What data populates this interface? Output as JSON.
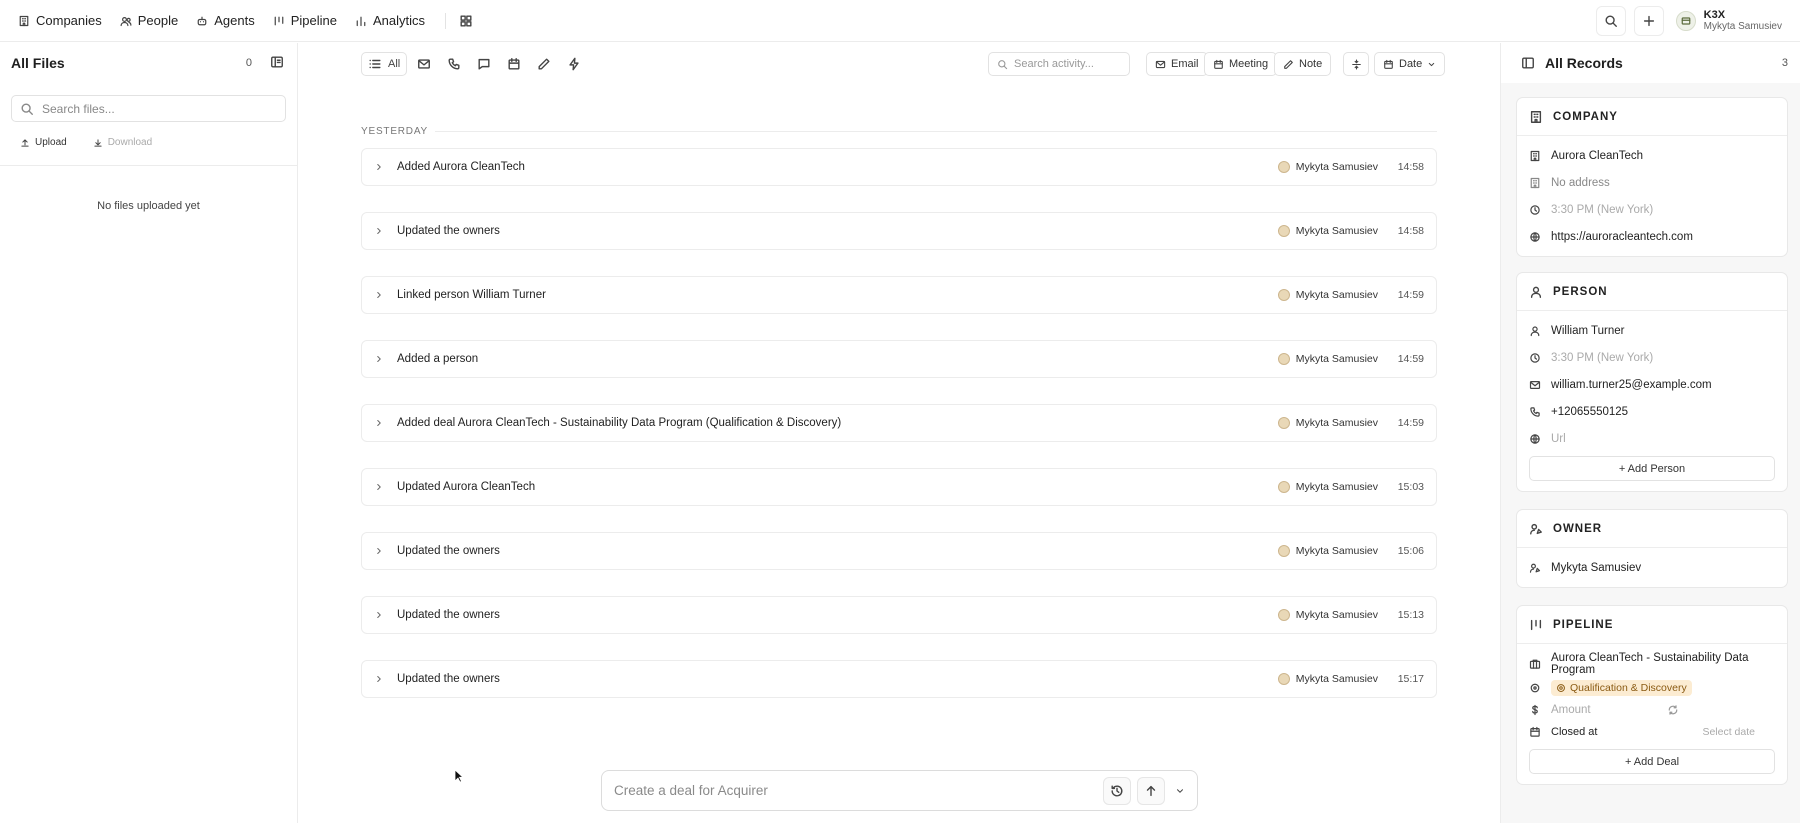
{
  "nav": {
    "items": [
      {
        "label": "Companies",
        "icon": "building-icon"
      },
      {
        "label": "People",
        "icon": "people-icon"
      },
      {
        "label": "Agents",
        "icon": "agent-icon"
      },
      {
        "label": "Pipeline",
        "icon": "pipeline-icon"
      },
      {
        "label": "Analytics",
        "icon": "chart-icon"
      }
    ],
    "account": {
      "name": "K3X",
      "user": "Mykyta Samusiev"
    }
  },
  "files": {
    "title": "All Files",
    "count": "0",
    "search_placeholder": "Search files...",
    "upload_label": "Upload",
    "download_label": "Download",
    "empty_text": "No files uploaded yet"
  },
  "activity": {
    "filter_all": "All",
    "search_placeholder": "Search activity...",
    "email_label": "Email",
    "meeting_label": "Meeting",
    "note_label": "Note",
    "date_label": "Date",
    "day_label": "YESTERDAY",
    "rows": [
      {
        "text": "Added Aurora CleanTech",
        "user": "Mykyta Samusiev",
        "time": "14:58"
      },
      {
        "text": "Updated the owners",
        "user": "Mykyta Samusiev",
        "time": "14:58"
      },
      {
        "text": "Linked person William Turner",
        "user": "Mykyta Samusiev",
        "time": "14:59"
      },
      {
        "text": "Added a person",
        "user": "Mykyta Samusiev",
        "time": "14:59"
      },
      {
        "text": "Added deal Aurora CleanTech - Sustainability Data Program (Qualification & Discovery)",
        "user": "Mykyta Samusiev",
        "time": "14:59"
      },
      {
        "text": "Updated Aurora CleanTech",
        "user": "Mykyta Samusiev",
        "time": "15:03"
      },
      {
        "text": "Updated the owners",
        "user": "Mykyta Samusiev",
        "time": "15:06"
      },
      {
        "text": "Updated the owners",
        "user": "Mykyta Samusiev",
        "time": "15:13"
      },
      {
        "text": "Updated the owners",
        "user": "Mykyta Samusiev",
        "time": "15:17"
      }
    ]
  },
  "composer": {
    "placeholder": "Create a deal for Acquirer"
  },
  "records": {
    "title": "All Records",
    "count": "3",
    "company": {
      "heading": "COMPANY",
      "name": "Aurora CleanTech",
      "address": "No address",
      "local_time": "3:30 PM (New York)",
      "website": "https://auroracleantech.com"
    },
    "person": {
      "heading": "PERSON",
      "name": "William Turner",
      "local_time": "3:30 PM (New York)",
      "email": "william.turner25@example.com",
      "phone": "+12065550125",
      "url_placeholder": "Url",
      "add_label": "+ Add Person"
    },
    "owner": {
      "heading": "OWNER",
      "name": "Mykyta Samusiev"
    },
    "pipeline": {
      "heading": "PIPELINE",
      "deal_name": "Aurora CleanTech - Sustainability Data Program",
      "stage": "Qualification & Discovery",
      "amount_label": "Amount",
      "closed_label": "Closed at",
      "closed_placeholder": "Select date",
      "add_label": "+ Add Deal"
    }
  },
  "colors": {
    "stage_badge_bg": "#fcecd2",
    "stage_badge_text": "#8a5a12"
  }
}
